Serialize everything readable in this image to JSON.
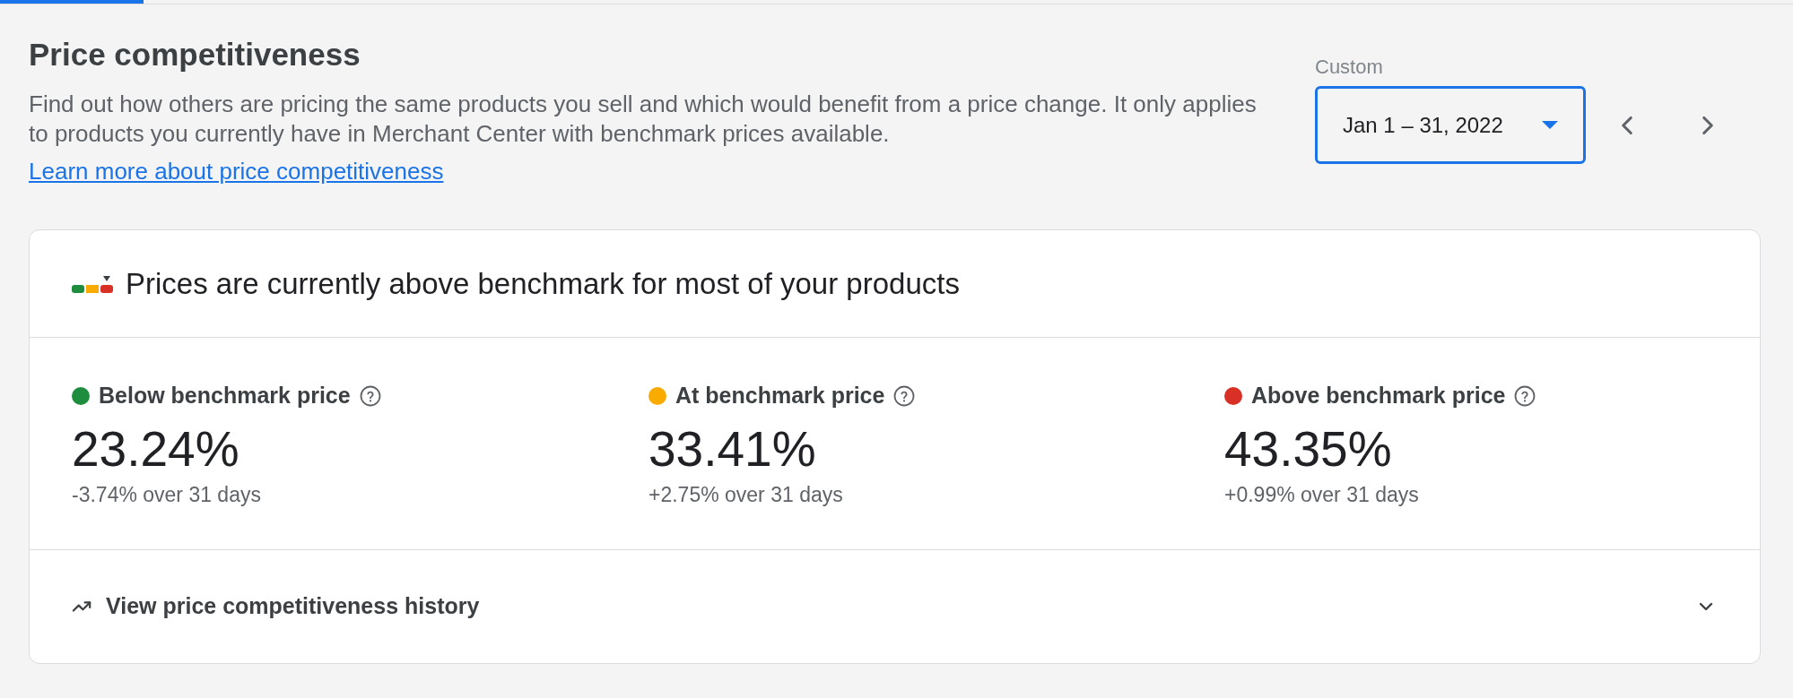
{
  "header": {
    "title": "Price competitiveness",
    "description": "Find out how others are pricing the same products you sell and which would benefit from a price change. It only applies to products you currently have in Merchant Center with benchmark prices available.",
    "link": "Learn more about price competitiveness"
  },
  "date_range": {
    "label": "Custom",
    "value": "Jan 1 – 31, 2022",
    "focused": true
  },
  "card": {
    "summary": "Prices are currently above benchmark for most of your products",
    "metrics": [
      {
        "label": "Below benchmark price",
        "color": "#1e8e3e",
        "value": "23.24%",
        "change": "-3.74% over 31 days"
      },
      {
        "label": "At benchmark price",
        "color": "#f9ab00",
        "value": "33.41%",
        "change": "+2.75% over 31 days"
      },
      {
        "label": "Above benchmark price",
        "color": "#d93025",
        "value": "43.35%",
        "change": "+0.99% over 31 days"
      }
    ],
    "history": {
      "label": "View price competitiveness history",
      "expanded": false
    }
  }
}
